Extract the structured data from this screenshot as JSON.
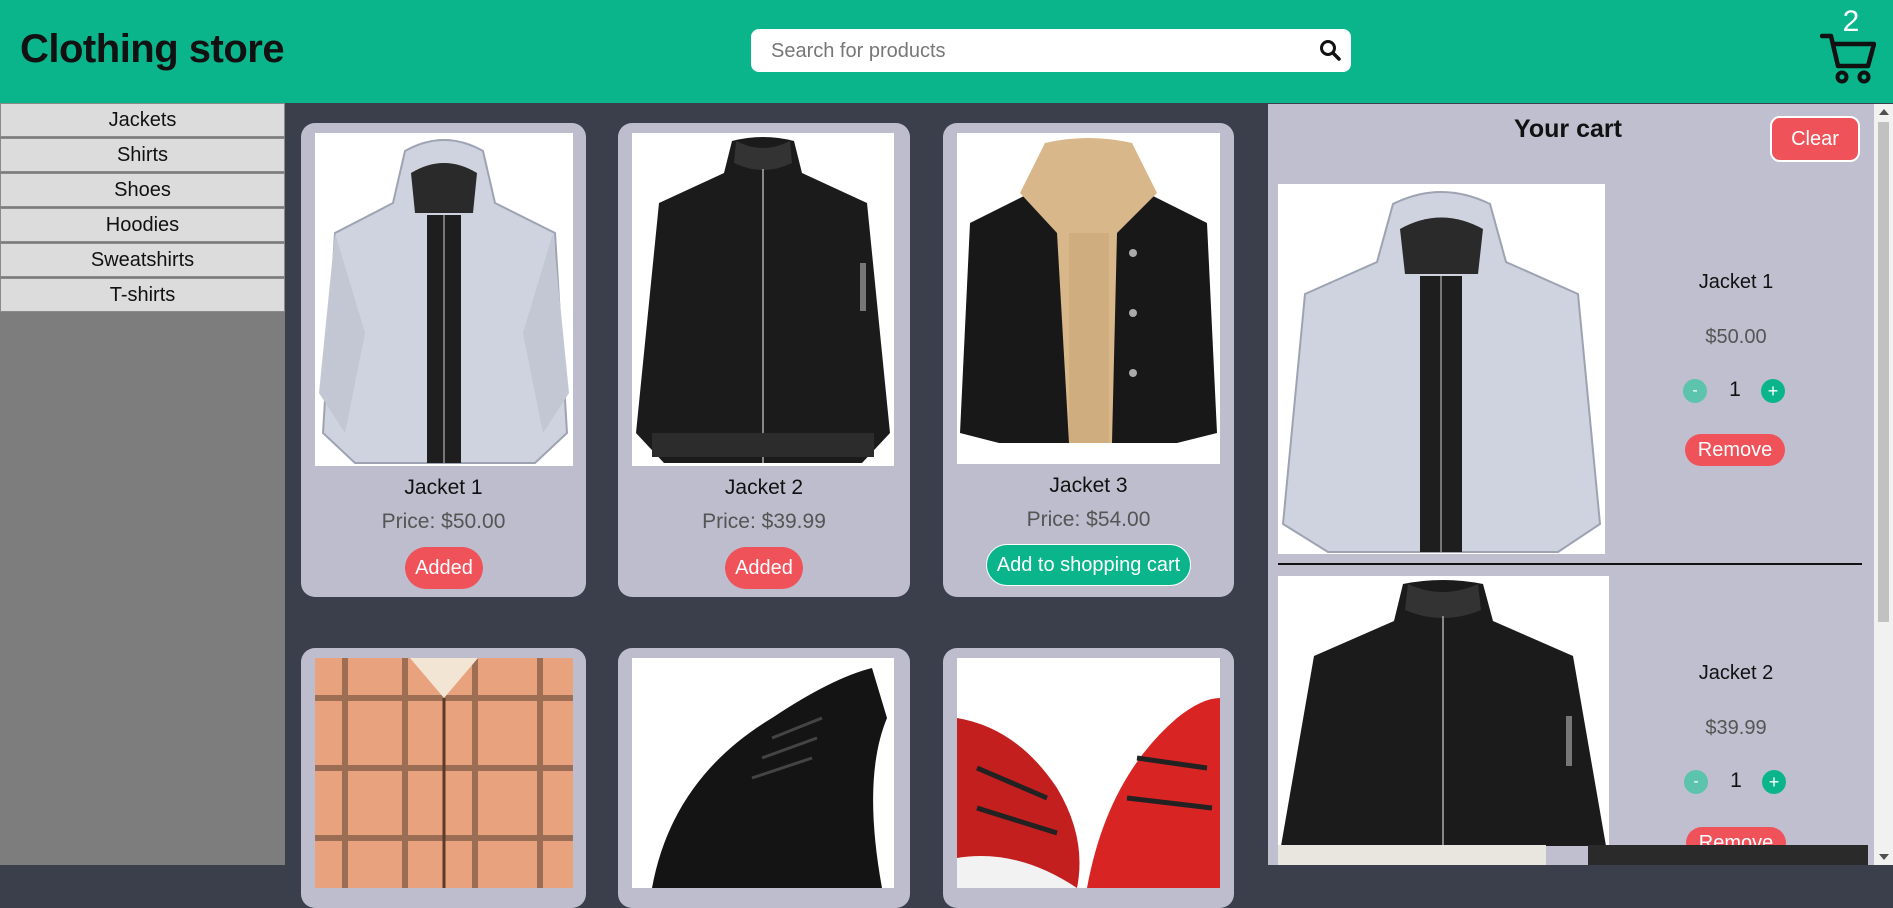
{
  "header": {
    "logo": "Clothing store",
    "search_placeholder": "Search for products",
    "cart_count": "2"
  },
  "sidebar": {
    "categories": [
      "Jackets",
      "Shirts",
      "Shoes",
      "Hoodies",
      "Sweatshirts",
      "T-shirts"
    ]
  },
  "products": [
    {
      "name": "Jacket 1",
      "price": "Price: $50.00",
      "button": "Added",
      "image": "light-grey-hooded-jacket"
    },
    {
      "name": "Jacket 2",
      "price": "Price: $39.99",
      "button": "Added",
      "image": "black-bomber-jacket"
    },
    {
      "name": "Jacket 3",
      "price": "Price: $54.00",
      "button": "Add to shopping cart",
      "image": "black-sherpa-lined-jacket"
    },
    {
      "image": "orange-plaid-shirt"
    },
    {
      "image": "black-knit-sneaker"
    },
    {
      "image": "red-running-shoes"
    }
  ],
  "cart": {
    "title": "Your cart",
    "clear_label": "Clear",
    "items": [
      {
        "name": "Jacket 1",
        "price": "$50.00",
        "qty": "1",
        "minus": "-",
        "plus": "+",
        "remove": "Remove"
      },
      {
        "name": "Jacket 2",
        "price": "$39.99",
        "qty": "1",
        "minus": "-",
        "plus": "+",
        "remove": "Remove"
      }
    ]
  },
  "colors": {
    "header": "#0ab58c",
    "sidebar": "#7d7d7d",
    "content_bg": "#3a3f4b",
    "card": "#bdbdcd",
    "added": "#f0525a",
    "add": "#0ab58c"
  }
}
